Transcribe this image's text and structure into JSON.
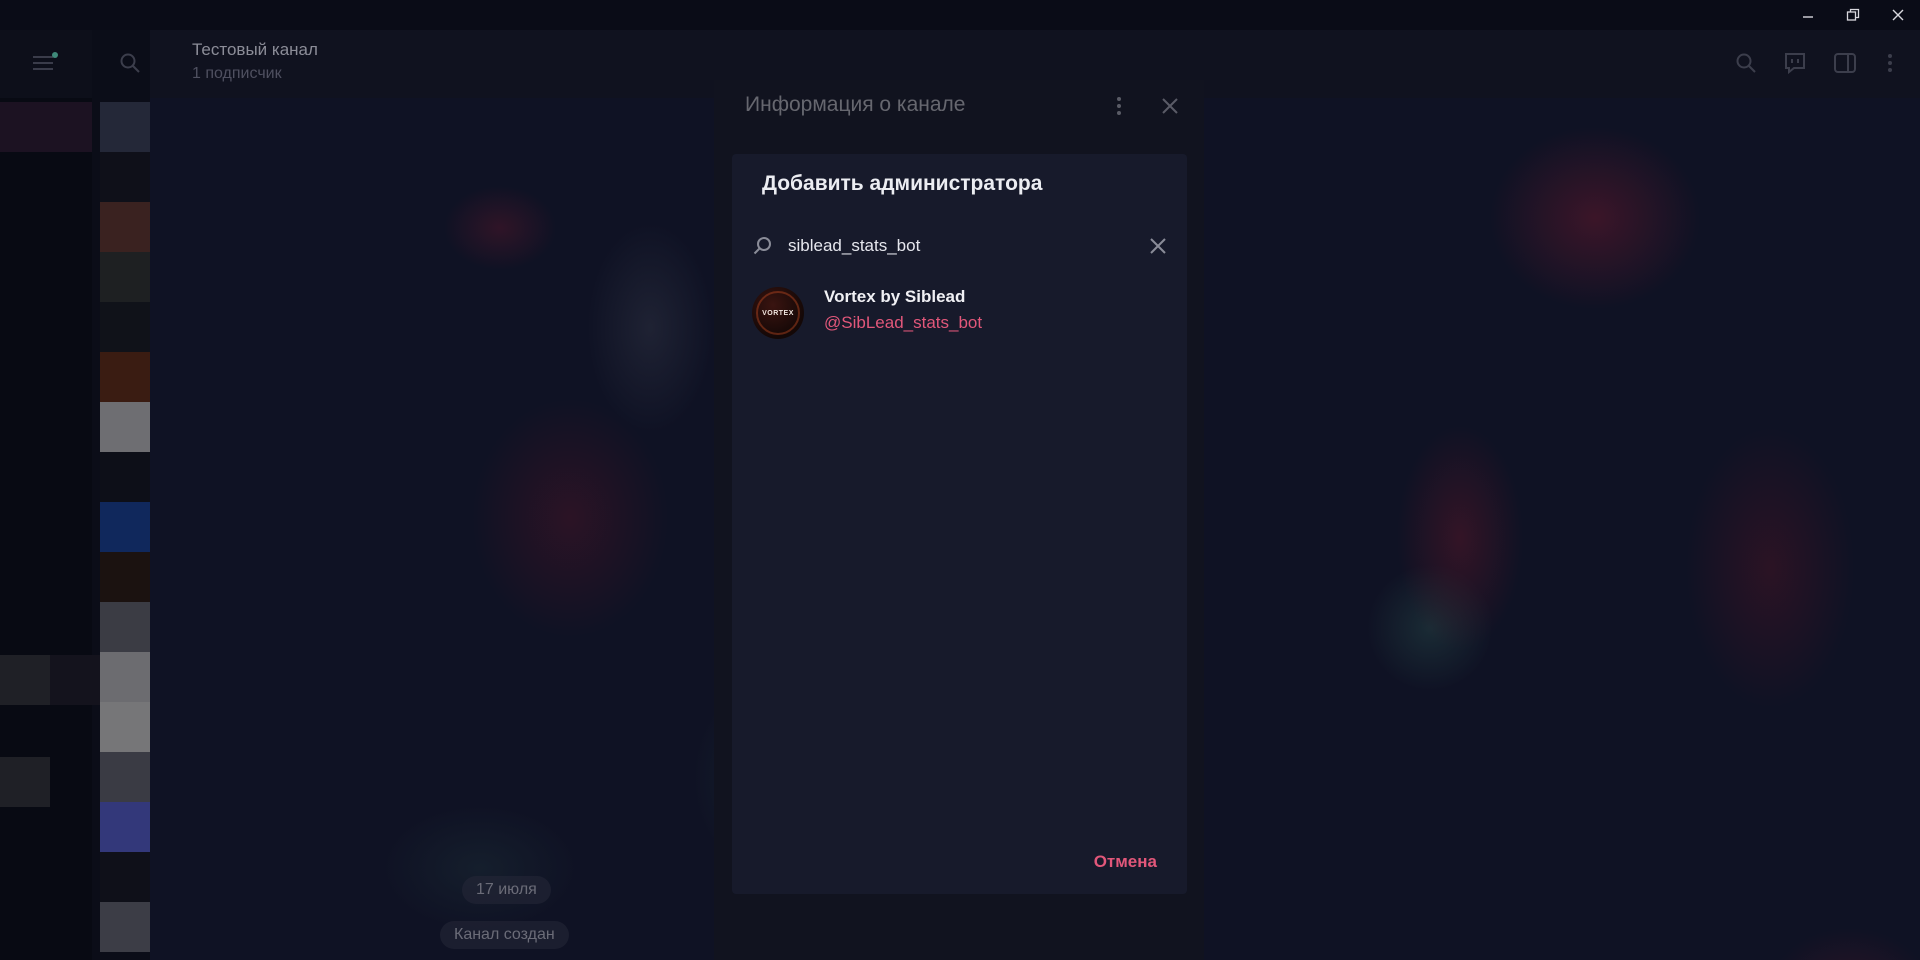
{
  "window": {
    "minimize_icon": "minimize-icon",
    "restore_icon": "restore-icon",
    "close_icon": "close-icon"
  },
  "header": {
    "title": "Тестовый канал",
    "subtitle": "1 подписчик"
  },
  "info_panel": {
    "title": "Информация о канале"
  },
  "dialog": {
    "title": "Добавить администратора",
    "search_value": "siblead_stats_bot",
    "results": [
      {
        "name": "Vortex by Siblead",
        "username": "@SibLead_stats_bot",
        "avatar_text": "VORTEX"
      }
    ],
    "cancel_label": "Отмена"
  },
  "chat": {
    "date_label": "17 июля",
    "service_message": "Канал создан"
  },
  "colors": {
    "accent": "#e2577a",
    "dialog_bg": "#171a2b",
    "app_bg": "#0d0f1c"
  }
}
